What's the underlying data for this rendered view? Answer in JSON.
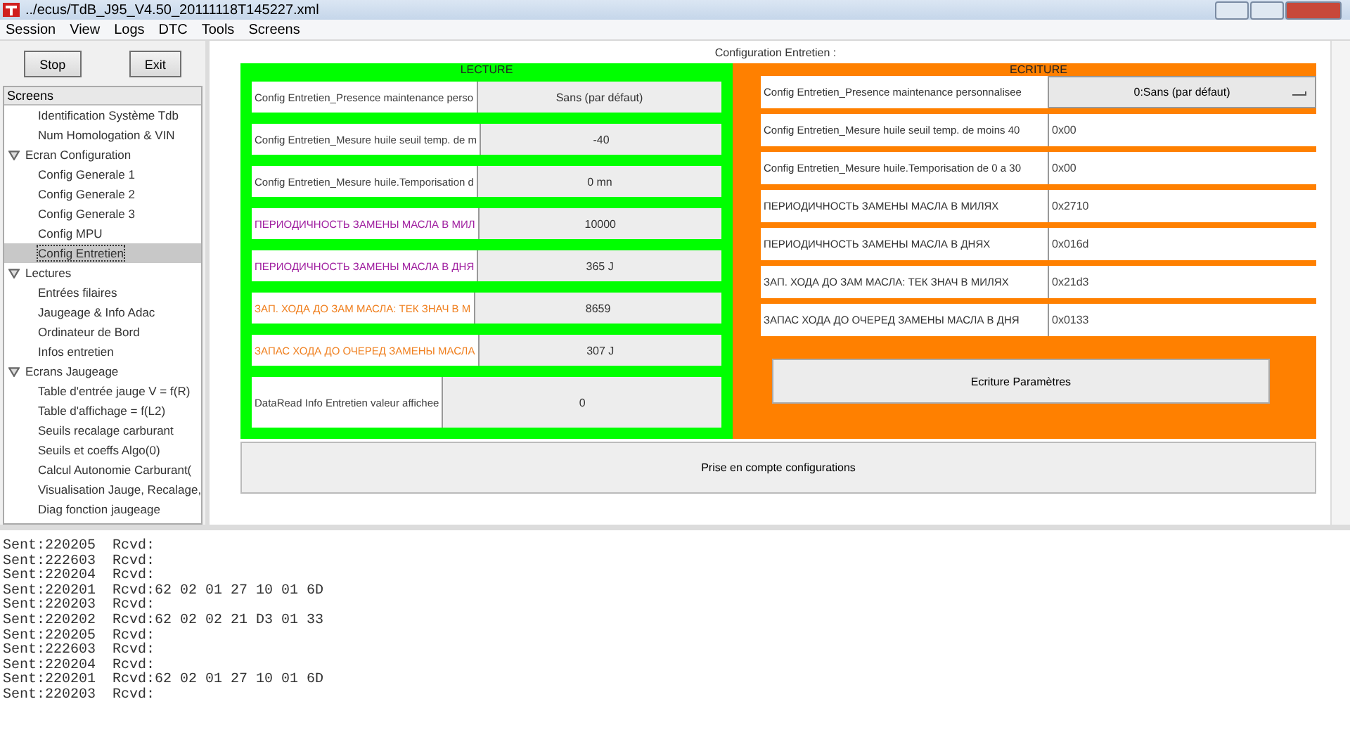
{
  "window": {
    "title": "../ecus/TdB_J95_V4.50_20111118T145227.xml"
  },
  "menu": [
    "Session",
    "View",
    "Logs",
    "DTC",
    "Tools",
    "Screens"
  ],
  "sidebar": {
    "buttons": [
      "Stop",
      "Exit"
    ],
    "header": "Screens",
    "tree": [
      {
        "label": "Identification Système Tdb",
        "selected": false
      },
      {
        "label": "Num Homologation & VIN",
        "selected": false
      },
      {
        "label": "Ecran Configuration",
        "expanded": true,
        "selected": false,
        "children": [
          {
            "label": "Config Generale 1",
            "selected": false
          },
          {
            "label": "Config Generale 2",
            "selected": false
          },
          {
            "label": "Config Generale 3",
            "selected": false
          },
          {
            "label": "Config MPU",
            "selected": false
          },
          {
            "label": "Config Entretien",
            "selected": true
          }
        ]
      },
      {
        "label": "Lectures",
        "expanded": true,
        "selected": false,
        "children": [
          {
            "label": "Entrées filaires",
            "selected": false
          },
          {
            "label": "Jaugeage & Info Adac",
            "selected": false
          },
          {
            "label": "Ordinateur de Bord",
            "selected": false
          },
          {
            "label": "Infos entretien",
            "selected": false
          }
        ]
      },
      {
        "label": "Ecrans Jaugeage",
        "expanded": true,
        "selected": false,
        "children": [
          {
            "label": "Table d'entrée jauge V = f(R)",
            "selected": false
          },
          {
            "label": "Table d'affichage = f(L2)",
            "selected": false
          },
          {
            "label": "Seuils recalage carburant",
            "selected": false
          },
          {
            "label": "Seuils et coeffs Algo(0)",
            "selected": false
          },
          {
            "label": "Calcul Autonomie Carburant(",
            "selected": false
          },
          {
            "label": "Visualisation Jauge, Recalage,",
            "selected": false
          },
          {
            "label": "Diag fonction jaugeage",
            "selected": false
          }
        ]
      }
    ]
  },
  "content": {
    "title": "Configuration Entretien :",
    "lecture": {
      "title": "LECTURE",
      "rows": [
        {
          "label": "Config Entretien_Presence maintenance perso",
          "value": "Sans (par défaut)",
          "color": "#404040"
        },
        {
          "label": "Config Entretien_Mesure huile seuil temp. de m",
          "value": "-40",
          "color": "#404040"
        },
        {
          "label": "Config Entretien_Mesure huile.Temporisation d",
          "value": "0 mn",
          "color": "#404040"
        },
        {
          "label": "ПЕРИОДИЧНОСТЬ ЗАМЕНЫ МАСЛА В МИЛ",
          "value": "10000",
          "color": "#a020a0"
        },
        {
          "label": "ПЕРИОДИЧНОСТЬ ЗАМЕНЫ МАСЛА В ДНЯ",
          "value": "365 J",
          "color": "#a020a0"
        },
        {
          "label": "ЗАП. ХОДА ДО ЗАМ МАСЛА: ТЕК ЗНАЧ В М",
          "value": "8659",
          "color": "#f08020"
        },
        {
          "label": "ЗАПАС ХОДА ДО ОЧЕРЕД ЗАМЕНЫ МАСЛА",
          "value": "307 J",
          "color": "#f08020"
        },
        {
          "label": "DataRead Info Entretien valeur affichee",
          "value": "0",
          "color": "#404040"
        }
      ]
    },
    "ecriture": {
      "title": "ECRITURE",
      "rows": [
        {
          "kind": "dropdown",
          "label": "Config Entretien_Presence maintenance personnalisee",
          "value": "0:Sans (par défaut)"
        },
        {
          "kind": "input",
          "label": "Config Entretien_Mesure huile seuil temp. de moins 40",
          "value": "0x00"
        },
        {
          "kind": "input",
          "label": "Config Entretien_Mesure huile.Temporisation de 0 a 30",
          "value": "0x00"
        },
        {
          "kind": "input",
          "label": "ПЕРИОДИЧНОСТЬ ЗАМЕНЫ МАСЛА В МИЛЯХ",
          "value": "0x2710"
        },
        {
          "kind": "input",
          "label": "ПЕРИОДИЧНОСТЬ ЗАМЕНЫ МАСЛА В ДНЯХ",
          "value": "0x016d"
        },
        {
          "kind": "input",
          "label": "ЗАП. ХОДА ДО ЗАМ МАСЛА: ТЕК ЗНАЧ В МИЛЯХ",
          "value": "0x21d3"
        },
        {
          "kind": "input",
          "label": "ЗАПАС ХОДА ДО ОЧЕРЕД ЗАМЕНЫ МАСЛА В ДНЯ",
          "value": "0x0133"
        }
      ],
      "button": "Ecriture Paramètres"
    },
    "apply_button": "Prise en compte configurations"
  },
  "log": [
    "Sent:220205  Rcvd:",
    "Sent:222603  Rcvd:",
    "Sent:220204  Rcvd:",
    "Sent:220201  Rcvd:62 02 01 27 10 01 6D",
    "Sent:220203  Rcvd:",
    "Sent:220202  Rcvd:62 02 02 21 D3 01 33",
    "Sent:220205  Rcvd:",
    "Sent:222603  Rcvd:",
    "Sent:220204  Rcvd:",
    "Sent:220201  Rcvd:62 02 01 27 10 01 6D",
    "Sent:220203  Rcvd:"
  ]
}
